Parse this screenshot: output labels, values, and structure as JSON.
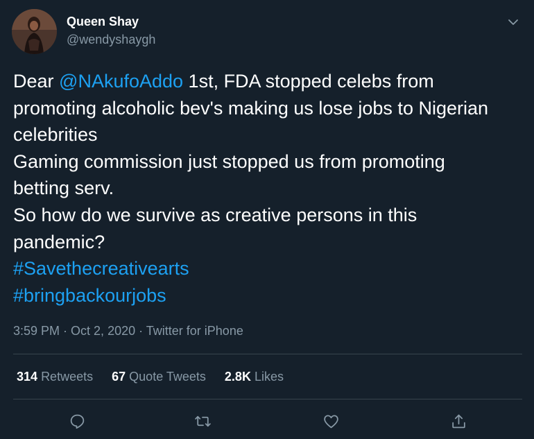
{
  "user": {
    "name": "Queen Shay",
    "handle": "@wendyshaygh"
  },
  "tweet": {
    "line1_prefix": "Dear ",
    "mention": "@NAkufoAddo",
    "line1_suffix": " 1st, FDA stopped celebs from",
    "line2": "promoting alcoholic bev's making us lose jobs to Nigerian",
    "line3": "celebrities",
    "line4": "Gaming commission just stopped us from promoting",
    "line5": "betting serv.",
    "line6": "So how do we survive as creative persons in this",
    "line7": "pandemic?",
    "hashtag1": "#Savethecreativearts",
    "hashtag2": "#bringbackourjobs"
  },
  "meta": {
    "time": "3:59 PM",
    "sep1": " · ",
    "date": "Oct 2, 2020",
    "sep2": " · ",
    "source": "Twitter for iPhone"
  },
  "stats": {
    "retweets_count": "314",
    "retweets_label": "Retweets",
    "quotes_count": "67",
    "quotes_label": "Quote Tweets",
    "likes_count": "2.8K",
    "likes_label": "Likes"
  },
  "icons": {
    "reply": "reply-icon",
    "retweet": "retweet-icon",
    "like": "heart-icon",
    "share": "share-icon",
    "caret": "chevron-down-icon"
  },
  "colors": {
    "background": "#15202b",
    "text": "#ffffff",
    "secondary": "#8899a6",
    "link": "#1da1f2",
    "divider": "#38444d"
  }
}
